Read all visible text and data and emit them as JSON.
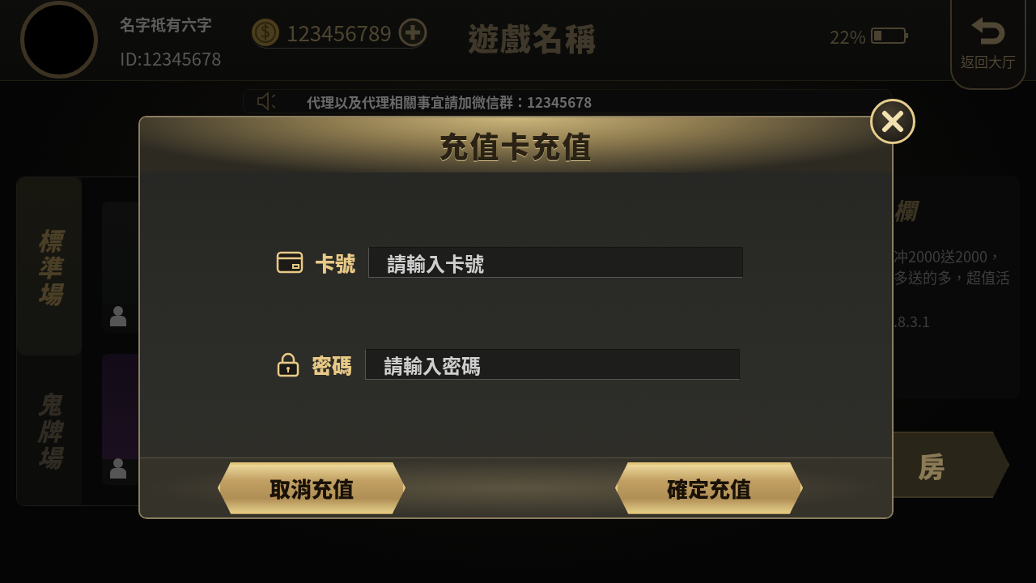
{
  "top_bar": {
    "player_name": "名字祗有六字",
    "player_id": "ID:12345678",
    "coins": "123456789",
    "game_title": "遊戲名稱",
    "battery_percent": "22%",
    "back_button": "返回大厅"
  },
  "notice": {
    "text": "代理以及代理相關事宜請加微信群：12345678"
  },
  "mode_tabs": [
    {
      "label": "標準場",
      "selected": true
    },
    {
      "label": "鬼牌場",
      "selected": false
    }
  ],
  "room_cards": [
    {
      "kind": "standard"
    },
    {
      "kind": "ghost"
    }
  ],
  "info_panel": {
    "title": "欄",
    "lines": [
      "冲2000送2000，",
      "多送的多，超值活"
    ],
    "version": ".8.3.1"
  },
  "room_button": {
    "label": "房"
  },
  "dialog": {
    "title": "充值卡充值",
    "fields": [
      {
        "kind": "card",
        "label": "卡號",
        "placeholder": "請輸入卡號"
      },
      {
        "kind": "lock",
        "label": "密碼",
        "placeholder": "請輸入密碼"
      }
    ],
    "buttons": [
      "取消充值",
      "確定充值"
    ]
  }
}
